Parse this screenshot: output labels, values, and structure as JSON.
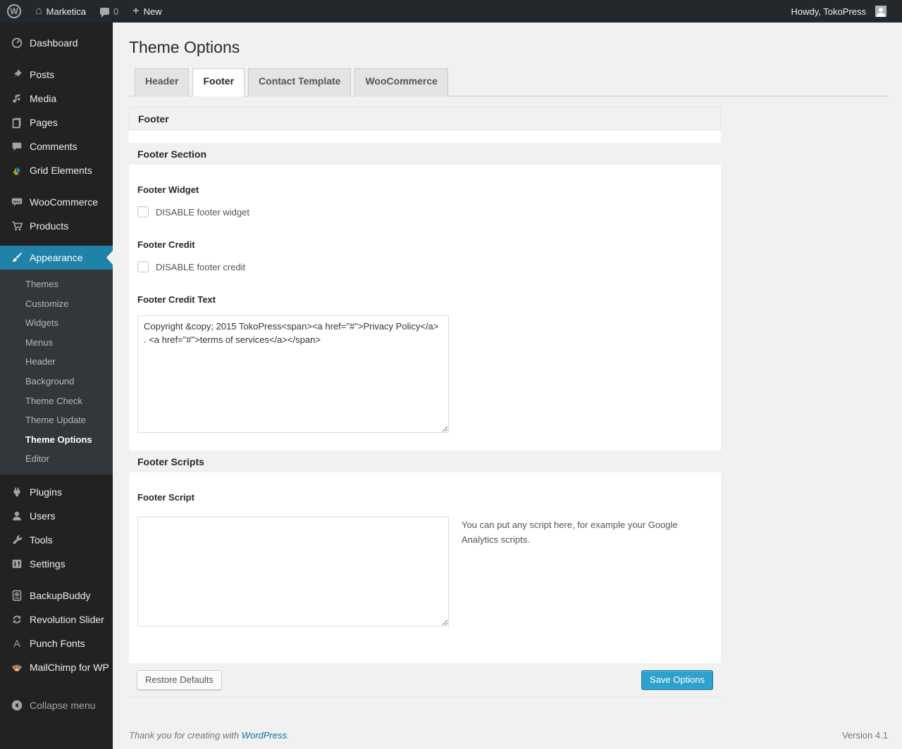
{
  "admin_bar": {
    "site_name": "Marketica",
    "comment_count": "0",
    "new_label": "New",
    "howdy": "Howdy, TokoPress"
  },
  "sidebar": {
    "items": [
      "Dashboard",
      "Posts",
      "Media",
      "Pages",
      "Comments",
      "Grid Elements",
      "WooCommerce",
      "Products",
      "Appearance",
      "Plugins",
      "Users",
      "Tools",
      "Settings",
      "BackupBuddy",
      "Revolution Slider",
      "Punch Fonts",
      "MailChimp for WP"
    ],
    "appearance_submenu": [
      "Themes",
      "Customize",
      "Widgets",
      "Menus",
      "Header",
      "Background",
      "Theme Check",
      "Theme Update",
      "Theme Options",
      "Editor"
    ],
    "current_item": "Appearance",
    "current_submenu_item": "Theme Options",
    "collapse": "Collapse menu"
  },
  "page": {
    "title": "Theme Options"
  },
  "tabs": [
    "Header",
    "Footer",
    "Contact Template",
    "WooCommerce"
  ],
  "active_tab": "Footer",
  "panel": {
    "title": "Footer",
    "section1": "Footer Section",
    "footer_widget_label": "Footer Widget",
    "footer_widget_checkbox": "DISABLE footer widget",
    "footer_widget_checked": false,
    "footer_credit_label": "Footer Credit",
    "footer_credit_checkbox": "DISABLE footer credit",
    "footer_credit_checked": false,
    "footer_credit_text_label": "Footer Credit Text",
    "footer_credit_text_value": "Copyright &copy; 2015 TokoPress<span><a href=\"#\">Privacy Policy</a> . <a href=\"#\">terms of services</a></span>",
    "section2": "Footer Scripts",
    "footer_script_label": "Footer Script",
    "footer_script_value": "",
    "footer_script_hint": "You can put any script here, for example your Google Analytics scripts.",
    "restore_button": "Restore Defaults",
    "save_button": "Save Options"
  },
  "footer": {
    "thanks_prefix": "Thank you for creating with",
    "link": "WordPress",
    "suffix": ".",
    "version": "Version 4.1"
  },
  "colors": {
    "menu_highlight": "#2082a8",
    "primary_button": "#2ea2cc",
    "link": "#0074a2",
    "admin_bar_bg": "#23282d",
    "sidebar_bg": "#222222",
    "content_bg": "#f1f1f1"
  },
  "icons": {
    "wordpress_logo": "W",
    "home": "⌂",
    "plus": "+",
    "punch_fonts_letter": "A"
  }
}
